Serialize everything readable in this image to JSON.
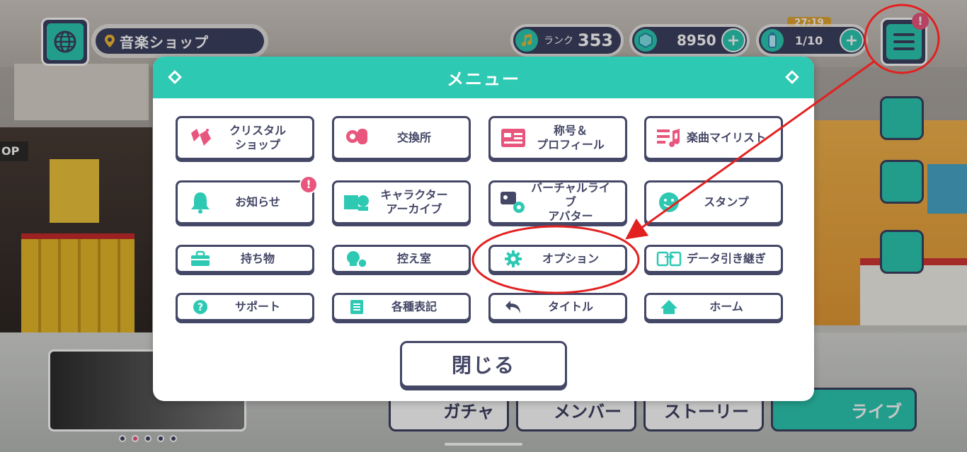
{
  "hud": {
    "location": "音楽ショップ",
    "rank_label": "ランク",
    "rank_value": "353",
    "crystal_count": "8950",
    "stamina": "1/10",
    "stamina_timer": "27:19",
    "menu_alert": "!"
  },
  "menu": {
    "title": "メニュー",
    "items": [
      {
        "label": "クリスタル\nショップ",
        "icon": "crystal-shop-icon",
        "color": "#e8567d"
      },
      {
        "label": "交換所",
        "icon": "exchange-icon",
        "color": "#e8567d"
      },
      {
        "label": "称号＆\nプロフィール",
        "icon": "profile-card-icon",
        "color": "#e8567d"
      },
      {
        "label": "楽曲マイリスト",
        "icon": "music-list-icon",
        "color": "#e8567d"
      },
      {
        "label": "お知らせ",
        "icon": "bell-icon",
        "color": "#2ec9b3",
        "alert": "!"
      },
      {
        "label": "キャラクター\nアーカイブ",
        "icon": "character-archive-icon",
        "color": "#2ec9b3"
      },
      {
        "label": "バーチャルライブ\nアバター",
        "icon": "avatar-settings-icon",
        "color": "#444766"
      },
      {
        "label": "スタンプ",
        "icon": "stamp-icon",
        "color": "#2ec9b3"
      },
      {
        "label": "持ち物",
        "icon": "bag-icon",
        "color": "#2ec9b3"
      },
      {
        "label": "控え室",
        "icon": "waiting-room-icon",
        "color": "#2ec9b3"
      },
      {
        "label": "オプション",
        "icon": "gear-icon",
        "color": "#2ec9b3"
      },
      {
        "label": "データ引き継ぎ",
        "icon": "data-transfer-icon",
        "color": "#2ec9b3"
      },
      {
        "label": "サポート",
        "icon": "help-icon",
        "color": "#2ec9b3"
      },
      {
        "label": "各種表記",
        "icon": "document-list-icon",
        "color": "#2ec9b3"
      },
      {
        "label": "タイトル",
        "icon": "back-arrow-icon",
        "color": "#444766"
      },
      {
        "label": "ホーム",
        "icon": "home-icon",
        "color": "#2ec9b3"
      }
    ],
    "close_label": "閉じる"
  },
  "bottom_nav": {
    "gacha": "ガチャ",
    "member": "メンバー",
    "story": "ストーリー",
    "live": "ライブ"
  },
  "colors": {
    "accent": "#2ec9b3",
    "navy": "#444766",
    "pink": "#e8567d",
    "annotation": "#e32020"
  }
}
